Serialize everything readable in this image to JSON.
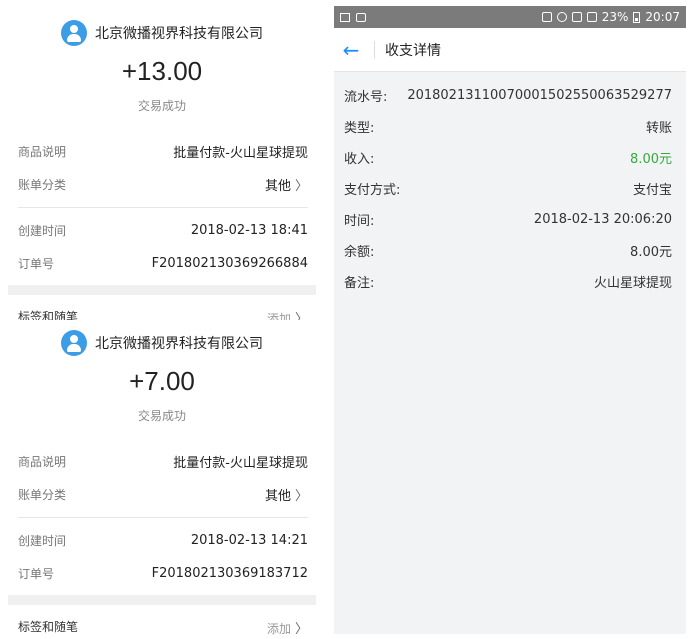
{
  "receipts": [
    {
      "merchant": "北京微播视界科技有限公司",
      "amount": "+13.00",
      "status": "交易成功",
      "product_label": "商品说明",
      "product_value": "批量付款-火山星球提现",
      "category_label": "账单分类",
      "category_value": "其他",
      "created_label": "创建时间",
      "created_value": "2018-02-13 18:41",
      "order_label": "订单号",
      "order_value": "F201802130369266884",
      "tags_label": "标签和随笔",
      "tags_action": "添加"
    },
    {
      "merchant": "北京微播视界科技有限公司",
      "amount": "+7.00",
      "status": "交易成功",
      "product_label": "商品说明",
      "product_value": "批量付款-火山星球提现",
      "category_label": "账单分类",
      "category_value": "其他",
      "created_label": "创建时间",
      "created_value": "2018-02-13 14:21",
      "order_label": "订单号",
      "order_value": "F201802130369183712",
      "tags_label": "标签和随笔",
      "tags_action": "添加"
    }
  ],
  "phone": {
    "statusbar": {
      "battery": "23%",
      "time": "20:07"
    },
    "title": "收支详情",
    "rows": [
      {
        "label": "流水号:",
        "value": "20180213110070001502550063529277"
      },
      {
        "label": "类型:",
        "value": "转账"
      },
      {
        "label": "收入:",
        "value": "8.00元"
      },
      {
        "label": "支付方式:",
        "value": "支付宝"
      },
      {
        "label": "时间:",
        "value": "2018-02-13 20:06:20"
      },
      {
        "label": "余额:",
        "value": "8.00元"
      },
      {
        "label": "备注:",
        "value": "火山星球提现"
      }
    ]
  },
  "colors": {
    "accent": "#1a8cff",
    "income_green": "#38a83e",
    "avatar_blue": "#3d9ce6"
  }
}
